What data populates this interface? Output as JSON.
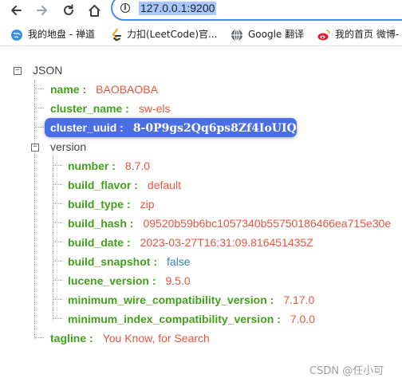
{
  "browser": {
    "url": "127.0.0.1:9200",
    "bookmarks": [
      {
        "label": "我的地盘 - 禅道",
        "icon": "globe-icon"
      },
      {
        "label": "力扣(LeetCode)官...",
        "icon": "leetcode-icon"
      },
      {
        "label": "Google 翻译",
        "icon": "globe-icon"
      },
      {
        "label": "我的首页 微博-",
        "icon": "weibo-icon"
      }
    ]
  },
  "json_viewer": {
    "root_label": "JSON",
    "fields": {
      "name": {
        "key": "name",
        "value": "BAOBAOBA"
      },
      "cluster_name": {
        "key": "cluster_name",
        "value": "sw-els"
      },
      "cluster_uuid": {
        "key": "cluster_uuid",
        "value": "8-0P9gs2Qq6ps8Zf4IoUIQ"
      },
      "version": {
        "key": "version"
      },
      "tagline": {
        "key": "tagline",
        "value": "You Know, for Search"
      }
    },
    "version_fields": [
      {
        "key": "number",
        "value": "8.7.0",
        "type": "string"
      },
      {
        "key": "build_flavor",
        "value": "default",
        "type": "string"
      },
      {
        "key": "build_type",
        "value": "zip",
        "type": "string"
      },
      {
        "key": "build_hash",
        "value": "09520b59b6bc1057340b55750186466ea715e30e",
        "type": "string"
      },
      {
        "key": "build_date",
        "value": "2023-03-27T16:31:09.816451435Z",
        "type": "string"
      },
      {
        "key": "build_snapshot",
        "value": "false",
        "type": "boolean"
      },
      {
        "key": "lucene_version",
        "value": "9.5.0",
        "type": "string"
      },
      {
        "key": "minimum_wire_compatibility_version",
        "value": "7.17.0",
        "type": "string"
      },
      {
        "key": "minimum_index_compatibility_version",
        "value": "7.0.0",
        "type": "string"
      }
    ],
    "colors": {
      "key": "#42a11a",
      "string": "#e8553d",
      "boolean": "#2f82c4",
      "highlight": "#4b6de6"
    }
  },
  "watermark": "CSDN @任小可"
}
